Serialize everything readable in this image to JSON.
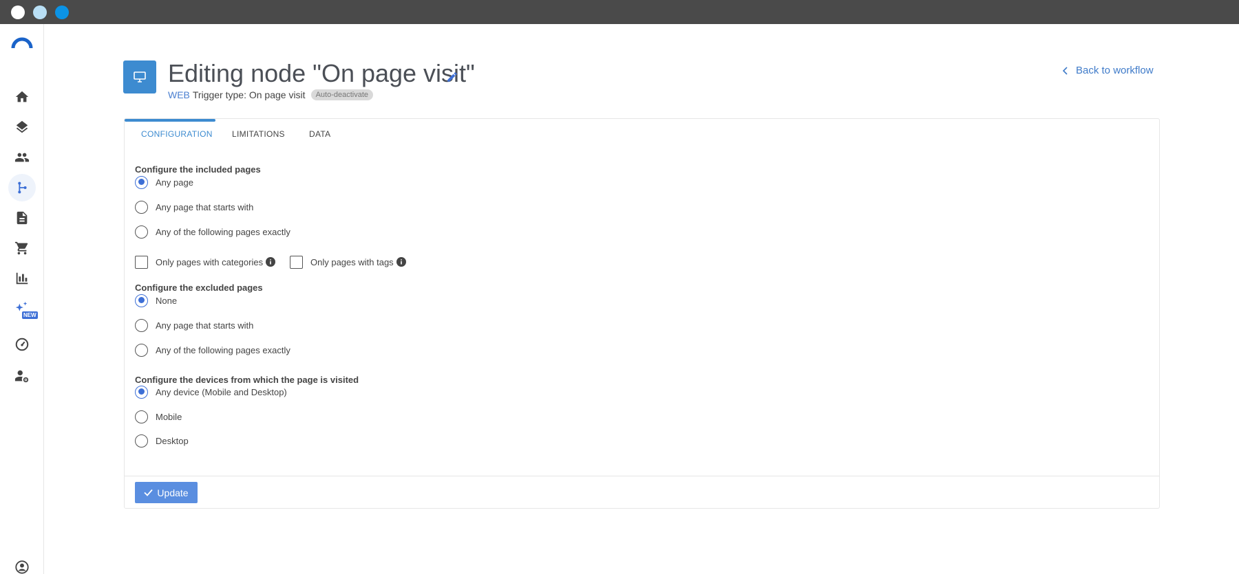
{
  "header": {
    "title": "Editing node \"On page visit\"",
    "channel": "WEB",
    "trigger_type": "Trigger type: On page visit",
    "badge": "Auto-deactivate",
    "back_link": "Back to workflow"
  },
  "tabs": [
    {
      "label": "CONFIGURATION",
      "active": true
    },
    {
      "label": "LIMITATIONS",
      "active": false
    },
    {
      "label": "DATA",
      "active": false
    }
  ],
  "included": {
    "label": "Configure the included pages",
    "options": [
      "Any page",
      "Any page that starts with",
      "Any of the following pages exactly"
    ],
    "selected": "Any page"
  },
  "filters": {
    "categories": "Only pages with categories",
    "tags": "Only pages with tags"
  },
  "excluded": {
    "label": "Configure the excluded pages",
    "options": [
      "None",
      "Any page that starts with",
      "Any of the following pages exactly"
    ],
    "selected": "None"
  },
  "devices": {
    "label": "Configure the devices from which the page is visited",
    "options": [
      "Any device (Mobile and Desktop)",
      "Mobile",
      "Desktop"
    ],
    "selected": "Any device (Mobile and Desktop)"
  },
  "footer": {
    "update_label": "Update"
  },
  "sidebar": {
    "new_badge": "NEW"
  },
  "colors": {
    "accent": "#3d8bd0",
    "primary_button": "#5a8ee0",
    "link": "#3f7bc9"
  }
}
